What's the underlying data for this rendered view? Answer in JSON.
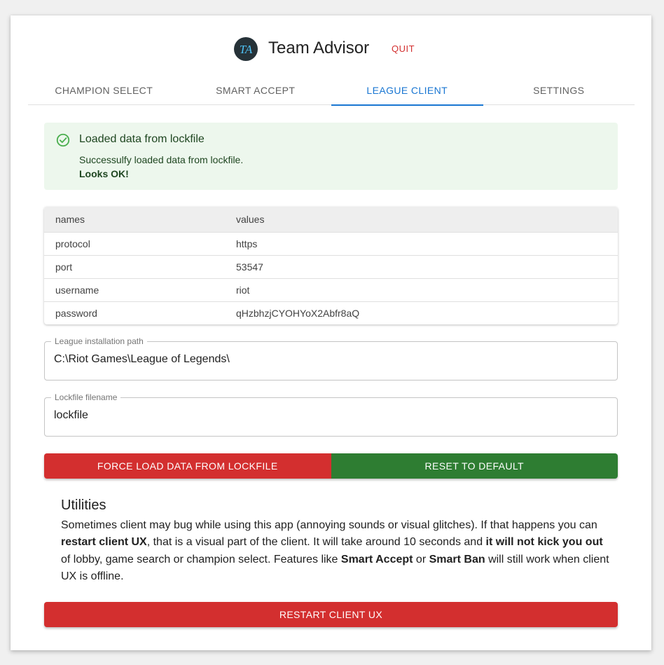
{
  "app": {
    "title": "Team Advisor",
    "logo_text": "TA",
    "quit_label": "QUIT"
  },
  "tabs": [
    {
      "label": "CHAMPION SELECT",
      "active": false
    },
    {
      "label": "SMART ACCEPT",
      "active": false
    },
    {
      "label": "LEAGUE CLIENT",
      "active": true
    },
    {
      "label": "SETTINGS",
      "active": false
    }
  ],
  "alert": {
    "icon": "check-circle-icon",
    "title": "Loaded data from lockfile",
    "message": "Successulfy loaded data from lockfile.",
    "strong": "Looks OK!"
  },
  "table": {
    "headers": [
      "names",
      "values"
    ],
    "rows": [
      [
        "protocol",
        "https"
      ],
      [
        "port",
        "53547"
      ],
      [
        "username",
        "riot"
      ],
      [
        "password",
        "qHzbhzjCYOHYoX2Abfr8aQ"
      ]
    ]
  },
  "fields": {
    "install_path": {
      "label": "League installation path",
      "value": "C:\\Riot Games\\League of Legends\\"
    },
    "lockfile_name": {
      "label": "Lockfile filename",
      "value": "lockfile"
    }
  },
  "buttons": {
    "force_load": "FORCE LOAD DATA FROM LOCKFILE",
    "reset_default": "RESET TO DEFAULT",
    "restart_ux": "RESTART CLIENT UX"
  },
  "utilities": {
    "title": "Utilities",
    "p1": "Sometimes client may bug while using this app (annoying sounds or visual glitches). If that happens you can ",
    "b1": "restart client UX",
    "p2": ", that is a visual part of the client. It will take around 10 seconds and ",
    "b2": "it will not kick you out",
    "p3": " of lobby, game search or champion select. Features like ",
    "b3": "Smart Accept",
    "p4": " or ",
    "b4": "Smart Ban",
    "p5": " will still work when client UX is offline."
  },
  "colors": {
    "accent": "#1976d2",
    "danger": "#d32f2f",
    "success": "#2e7d32",
    "alert_bg": "#edf7ed"
  }
}
